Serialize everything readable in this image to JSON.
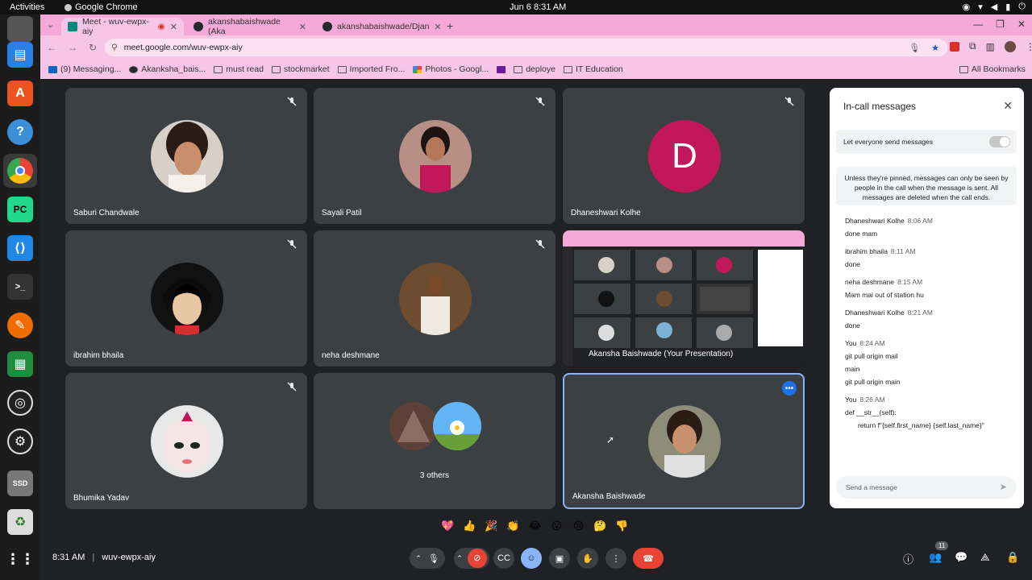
{
  "system": {
    "activities": "Activities",
    "app_name": "Google Chrome",
    "clock": "Jun 6  8:31 AM"
  },
  "browser": {
    "tabs": [
      {
        "label": "Meet - wuv-ewpx-aiy",
        "active": true
      },
      {
        "label": "akanshabaishwade (Aka",
        "active": false
      },
      {
        "label": "akanshabaishwade/Djan",
        "active": false
      }
    ],
    "url": "meet.google.com/wuv-ewpx-aiy",
    "bookmarks": [
      "(9) Messaging...",
      "Akanksha_bais...",
      "must read",
      "stockmarket",
      "Imported Fro...",
      "Photos - Googl...",
      "",
      "deploye",
      "IT Education"
    ],
    "all_bookmarks": "All Bookmarks"
  },
  "tiles": [
    {
      "name": "Saburi Chandwale",
      "muted": true
    },
    {
      "name": "Sayali Patil",
      "muted": true
    },
    {
      "name": "Dhaneshwari Kolhe",
      "muted": true,
      "initial": "D",
      "color": "#c2185b"
    },
    {
      "name": "ibrahim bhaila",
      "muted": true
    },
    {
      "name": "neha deshmane",
      "muted": true
    },
    {
      "name": "Akansha Baishwade (Your Presentation)",
      "muted": false
    },
    {
      "name": "Bhumika Yadav",
      "muted": true
    },
    {
      "name": "3 others",
      "muted": false
    },
    {
      "name": "Akansha Baishwade",
      "muted": false
    }
  ],
  "chat": {
    "title": "In-call messages",
    "toggle_label": "Let everyone send messages",
    "notice": "Unless they're pinned, messages can only be seen by people in the call when the message is sent. All messages are deleted when the call ends.",
    "messages": [
      {
        "from": "Dhaneshwari Kolhe",
        "time": "8:06 AM",
        "lines": [
          "done mam"
        ]
      },
      {
        "from": "ibrahim bhaila",
        "time": "8:11 AM",
        "lines": [
          "done"
        ]
      },
      {
        "from": "neha deshmane",
        "time": "8:15 AM",
        "lines": [
          "Mam mai out of station hu"
        ]
      },
      {
        "from": "Dhaneshwari Kolhe",
        "time": "8:21 AM",
        "lines": [
          "done"
        ]
      },
      {
        "from": "You",
        "time": "8:24 AM",
        "lines": [
          "git pull origin mail",
          "main",
          "git pull origin main"
        ]
      },
      {
        "from": "You",
        "time": "8:26 AM",
        "lines": [
          "def __str__(self):",
          "return f\"{self.first_name} {self.last_name}\""
        ]
      }
    ],
    "input_placeholder": "Send a message"
  },
  "bottom": {
    "time": "8:31 AM",
    "meeting_code": "wuv-ewpx-aiy",
    "participants_count": "11"
  },
  "colors": {
    "meet_bg": "#202124",
    "tile_bg": "#3c4043",
    "chrome_bg": "#f4a9d8",
    "end_call": "#ea4335",
    "accent": "#8ab4f8"
  }
}
